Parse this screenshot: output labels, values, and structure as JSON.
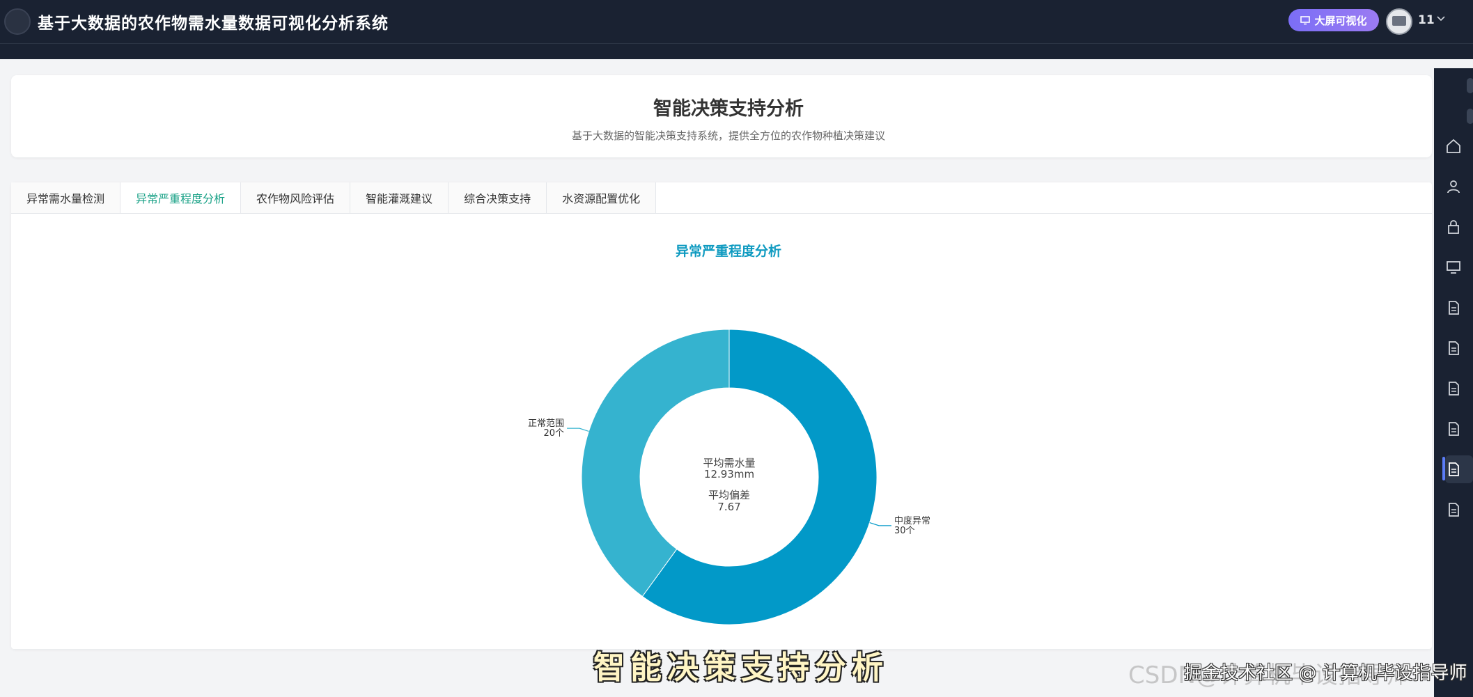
{
  "app": {
    "title": "基于大数据的农作物需水量数据可视化分析系统",
    "bigscreen_label": "大屏可视化",
    "username": "11"
  },
  "header": {
    "title": "智能决策支持分析",
    "subtitle": "基于大数据的智能决策支持系统，提供全方位的农作物种植决策建议"
  },
  "tabs": [
    {
      "label": "异常需水量检测"
    },
    {
      "label": "异常严重程度分析",
      "active": true
    },
    {
      "label": "农作物风险评估"
    },
    {
      "label": "智能灌溉建议"
    },
    {
      "label": "综合决策支持"
    },
    {
      "label": "水资源配置优化"
    }
  ],
  "chart_data": {
    "type": "pie",
    "title": "异常严重程度分析",
    "slices": [
      {
        "name": "中度异常",
        "value": 30,
        "label": "30个",
        "color": "#0299c8"
      },
      {
        "name": "正常范围",
        "value": 20,
        "label": "20个",
        "color": "#35b3cf"
      }
    ],
    "center": {
      "line1_label": "平均需水量",
      "line1_value": "12.93mm",
      "line2_label": "平均偏差",
      "line2_value": "7.67"
    }
  },
  "sidebar_icons": [
    "home-icon",
    "user-icon",
    "lock-icon",
    "presentation-icon",
    "document-icon",
    "document-icon",
    "document-icon",
    "document-icon",
    "document-icon",
    "document-icon"
  ],
  "overlay": {
    "caption": "智能决策支持分析",
    "watermark_faded": "CSDN@计算机毕设指导师",
    "watermark": "掘金技术社区 @ 计算机毕设指导师"
  },
  "colors": {
    "topbar": "#1a2232",
    "accent_tab": "#16a085",
    "chart_title": "#0e9ac0",
    "button_gradient_start": "#7b6ef6"
  }
}
